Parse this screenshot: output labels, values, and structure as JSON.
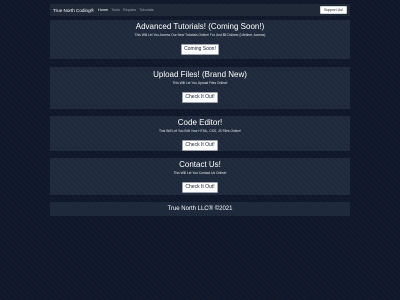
{
  "navbar": {
    "brand": "True North Coding®",
    "links": [
      "Home",
      "Tools",
      "Repairs",
      "Tutorials"
    ],
    "support_button": "Support Us!"
  },
  "cards": [
    {
      "title": "Advanced Tutorials! (Coming Soon!)",
      "subtitle": "This Will Let You Access Our New Tutorials Online! For Just $5 Dollars! (Lifetime, Access)",
      "button": "Coming Soon!"
    },
    {
      "title": "Upload Files! (Brand New)",
      "subtitle": "This Will Let You Upload Files Online!",
      "button": "Check It Out!"
    },
    {
      "title": "Code Editor!",
      "subtitle": "This Will Let You Edit Your HTML, CSS, JS Files Online!",
      "button": "Check It Out!"
    },
    {
      "title": "Contact Us!",
      "subtitle": "This Will Let You Contact Us Online!",
      "button": "Check It Out!"
    }
  ],
  "footer": {
    "text": "True North LLC® ©2021"
  }
}
